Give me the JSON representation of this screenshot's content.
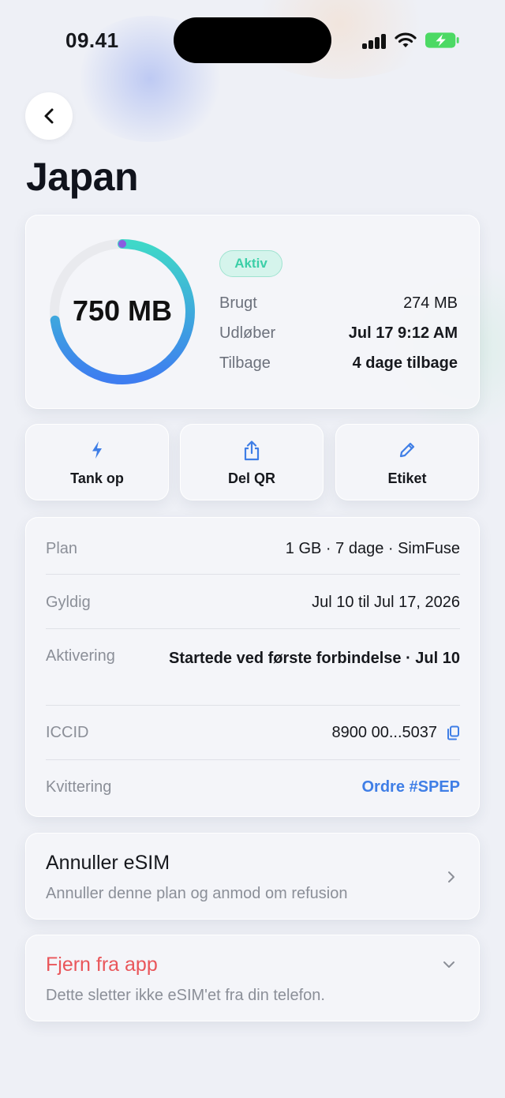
{
  "status_bar": {
    "time": "09.41"
  },
  "header": {
    "title": "Japan"
  },
  "usage": {
    "remaining": "750 MB",
    "remaining_fraction": 0.73,
    "status_badge": "Aktiv",
    "stats": [
      {
        "label": "Brugt",
        "value": "274 MB"
      },
      {
        "label": "Udløber",
        "value": "Jul 17 9:12 AM"
      },
      {
        "label": "Tilbage",
        "value": "4 dage tilbage"
      }
    ]
  },
  "actions": [
    {
      "label": "Tank op",
      "icon": "bolt-icon"
    },
    {
      "label": "Del QR",
      "icon": "share-icon"
    },
    {
      "label": "Etiket",
      "icon": "pencil-icon"
    }
  ],
  "details": [
    {
      "label": "Plan",
      "value": "1 GB · 7 dage · SimFuse"
    },
    {
      "label": "Gyldig",
      "value": "Jul 10 til Jul 17, 2026"
    },
    {
      "label": "Aktivering",
      "value": "Startede ved første forbindelse · Jul 10"
    },
    {
      "label": "ICCID",
      "value": "8900 00...5037"
    },
    {
      "label": "Kvittering",
      "value": "Ordre #SPEP"
    }
  ],
  "cancel": {
    "title": "Annuller eSIM",
    "subtitle": "Annuller denne plan og anmod om refusion"
  },
  "remove": {
    "title": "Fjern fra app",
    "subtitle": "Dette sletter ikke eSIM'et fra din telefon."
  },
  "colors": {
    "accent": "#3f7ee6",
    "danger": "#e9565a",
    "active": "#3ccfa8",
    "ring_start": "#3fd8c8",
    "ring_end": "#3e7df0"
  }
}
